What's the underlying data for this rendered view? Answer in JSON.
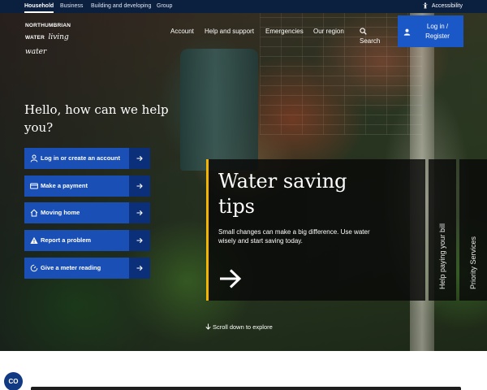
{
  "topbar": {
    "tabs": [
      "Household",
      "Business",
      "Building and developing",
      "Group"
    ],
    "accessibility": "Accessibility"
  },
  "logo": {
    "line1": "NORTHUMBRIAN",
    "line2_a": "WATER",
    "line2_b": "living water"
  },
  "nav": {
    "items": [
      "Account",
      "Help and support",
      "Emergencies",
      "Our region"
    ],
    "search": "Search",
    "login_line1": "Log in /",
    "login_line2": "Register"
  },
  "hero": {
    "greeting": "Hello, how can we help you?",
    "actions": [
      {
        "label": "Log in or create an account",
        "icon": "user-icon"
      },
      {
        "label": "Make a payment",
        "icon": "card-icon"
      },
      {
        "label": "Moving home",
        "icon": "home-icon"
      },
      {
        "label": "Report a problem",
        "icon": "warning-icon"
      },
      {
        "label": "Give a meter reading",
        "icon": "meter-icon"
      }
    ],
    "card": {
      "title": "Water saving tips",
      "description": "Small changes can make a big difference. Use water wisely and start saving today."
    },
    "side_tabs": [
      "Help paying your bill",
      "Priority Services"
    ],
    "scroll": "Scroll down to explore"
  },
  "cookie": {
    "label": "CO"
  },
  "colors": {
    "navy": "#0b1f3f",
    "primary_blue": "#1a4fb6",
    "accent_yellow": "#f5b400"
  }
}
